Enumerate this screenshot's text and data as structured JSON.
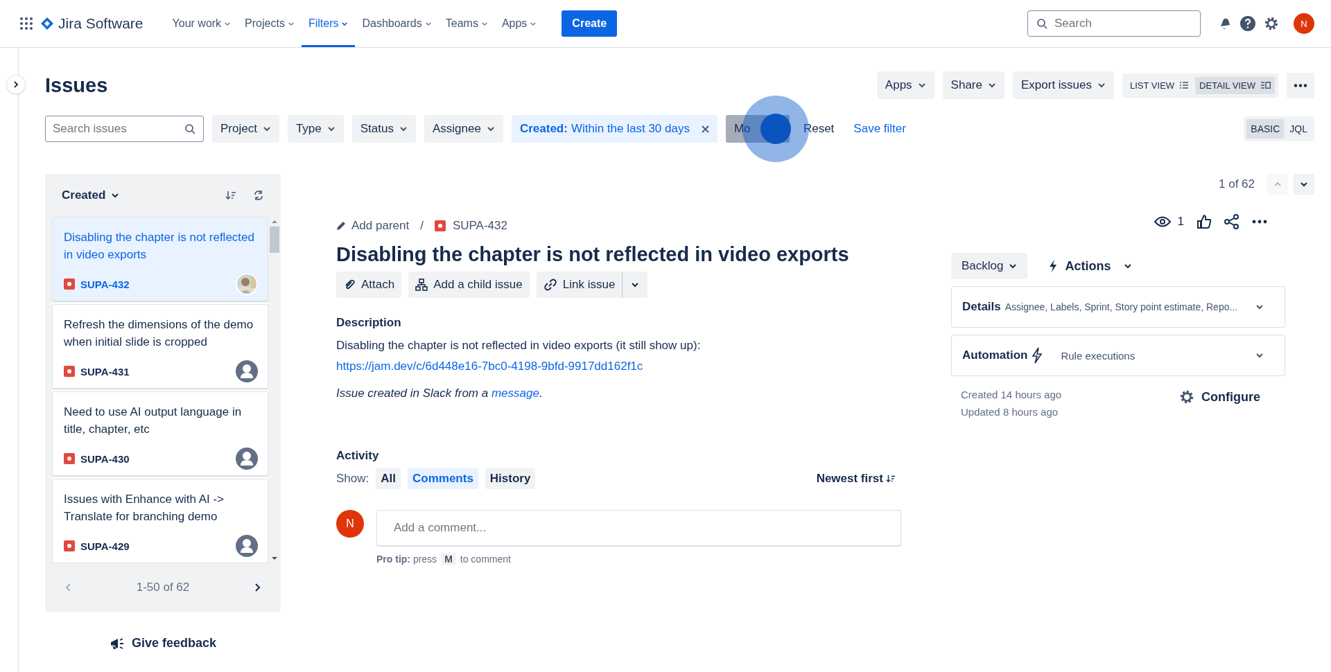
{
  "topnav": {
    "product": "Jira Software",
    "items": [
      {
        "label": "Your work",
        "selected": false
      },
      {
        "label": "Projects",
        "selected": false
      },
      {
        "label": "Filters",
        "selected": true
      },
      {
        "label": "Dashboards",
        "selected": false
      },
      {
        "label": "Teams",
        "selected": false
      },
      {
        "label": "Apps",
        "selected": false
      }
    ],
    "create": "Create",
    "search": {
      "placeholder": "Search"
    },
    "user_initial": "N"
  },
  "header": {
    "title": "Issues",
    "buttons": [
      "Apps",
      "Share",
      "Export issues"
    ],
    "views": [
      {
        "label": "LIST VIEW",
        "selected": false
      },
      {
        "label": "DETAIL VIEW",
        "selected": true
      }
    ]
  },
  "filters": {
    "search": {
      "placeholder": "Search issues"
    },
    "dropdowns": [
      "Project",
      "Type",
      "Status",
      "Assignee"
    ],
    "active_filter": {
      "label": "Created:",
      "value": "Within the last 30 days"
    },
    "more": "Mo",
    "reset": "Reset",
    "save": "Save filter",
    "modes": [
      {
        "label": "BASIC",
        "selected": true
      },
      {
        "label": "JQL",
        "selected": false
      }
    ]
  },
  "issue_list": {
    "sort": "Created",
    "issues": [
      {
        "summary": "Disabling the chapter is not reflected in video exports",
        "key": "SUPA-432",
        "selected": true
      },
      {
        "summary": "Refresh the dimensions of the demo when initial slide is cropped",
        "key": "SUPA-431",
        "selected": false,
        "kind": "default"
      },
      {
        "summary": "Need to use AI output language in title, chapter, etc",
        "key": "SUPA-430",
        "selected": false,
        "kind": "default"
      },
      {
        "summary": "Issues with Enhance with AI -> Translate for branching demo",
        "key": "SUPA-429",
        "selected": false,
        "kind": "default"
      }
    ],
    "pagination": "1-50 of 62",
    "feedback": "Give feedback"
  },
  "issue": {
    "position": "1 of 62",
    "add_parent": "Add parent",
    "separator": "/",
    "key": "SUPA-432",
    "watchers": "1",
    "title": "Disabling the chapter is not reflected in video exports",
    "actions": [
      "Attach",
      "Add a child issue",
      "Link issue"
    ],
    "description_heading": "Description",
    "description": "Disabling the chapter is not reflected in video exports (it still show up): ",
    "description_link": "https://jam.dev/c/6d448e16-7bc0-4198-9bfd-9917dd162f1c",
    "slack_note": "Issue created in Slack from a ",
    "slack_link": "message",
    "slack_end": ".",
    "activity_heading": "Activity",
    "show_label": "Show:",
    "activity_tabs": [
      {
        "label": "All",
        "selected": false
      },
      {
        "label": "Comments",
        "selected": true
      },
      {
        "label": "History",
        "selected": false
      }
    ],
    "order": "Newest first",
    "comment": {
      "avatar_initial": "N",
      "placeholder": "Add a comment..."
    },
    "pro_tip": "**Pro tip:** press",
    "pro_tip_key": "M",
    "pro_tip_end": "to comment"
  },
  "side": {
    "status": "Backlog",
    "actions": "Actions",
    "panels": [
      {
        "kind": "details",
        "title": "Details",
        "summary": "Assignee, Labels, Sprint, Story point estimate, Repo..."
      },
      {
        "kind": "automation",
        "title": "Automation",
        "summary": "Rule executions"
      }
    ],
    "created": "Created 14 hours ago",
    "updated": "Updated 8 hours ago",
    "configure": "Configure"
  }
}
